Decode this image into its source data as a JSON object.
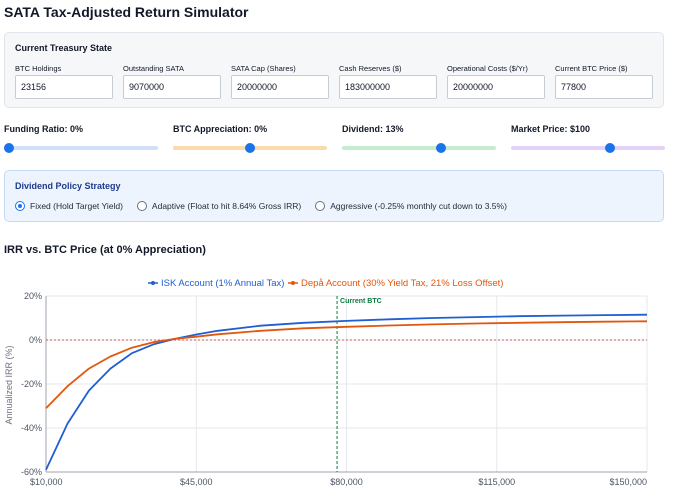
{
  "app": {
    "title": "SATA Tax-Adjusted Return Simulator"
  },
  "treasury": {
    "title": "Current Treasury State",
    "fields": [
      {
        "label": "BTC Holdings",
        "value": "23156"
      },
      {
        "label": "Outstanding SATA",
        "value": "9070000"
      },
      {
        "label": "SATA Cap (Shares)",
        "value": "20000000"
      },
      {
        "label": "Cash Reserves ($)",
        "value": "183000000"
      },
      {
        "label": "Operational Costs ($/Yr)",
        "value": "20000000"
      },
      {
        "label": "Current BTC Price ($)",
        "value": "77800"
      }
    ]
  },
  "sliders": [
    {
      "label": "Funding Ratio: 0%",
      "level": 0.0,
      "track_color": "#cfe0f7"
    },
    {
      "label": "BTC Appreciation: 0%",
      "level": 0.5,
      "track_color": "#fbdba9"
    },
    {
      "label": "Dividend: 13%",
      "level": 0.65,
      "track_color": "#c3edcc"
    },
    {
      "label": "Market Price: $100",
      "level": 0.65,
      "track_color": "#e5d2f7"
    }
  ],
  "policy": {
    "title": "Dividend Policy Strategy",
    "options": [
      {
        "label": "Fixed (Hold Target Yield)",
        "selected": true
      },
      {
        "label": "Adaptive (Float to hit 8.64% Gross IRR)",
        "selected": false
      },
      {
        "label": "Aggressive (-0.25% monthly cut down to 3.5%)",
        "selected": false
      }
    ]
  },
  "chart": {
    "title": "IRR vs. BTC Price (at 0% Appreciation)"
  },
  "chart_data": {
    "type": "line",
    "ylabel": "Annualized IRR (%)",
    "xlim": [
      10000,
      150000
    ],
    "ylim": [
      -60,
      20
    ],
    "x_ticks": [
      "$10,000",
      "$45,000",
      "$80,000",
      "$115,000",
      "$150,000"
    ],
    "y_ticks": [
      "20%",
      "0%",
      "-20%",
      "-40%",
      "-60%"
    ],
    "legend_position": "top-center",
    "zero_line": true,
    "current_marker": {
      "label": "Current BTC",
      "x": 77800
    },
    "series": [
      {
        "name": "ISK Account (1% Annual Tax)",
        "color": "#1f5fd1",
        "x": [
          10000,
          15000,
          20000,
          25000,
          30000,
          35000,
          40000,
          45000,
          50000,
          60000,
          70000,
          80000,
          90000,
          100000,
          110000,
          120000,
          130000,
          140000,
          150000
        ],
        "y": [
          -59,
          -38,
          -23,
          -13,
          -6,
          -2,
          0.5,
          2.5,
          4.2,
          6.5,
          7.8,
          8.7,
          9.4,
          10.0,
          10.4,
          10.8,
          11.1,
          11.3,
          11.5
        ]
      },
      {
        "name": "Depå Account (30% Yield Tax, 21% Loss Offset)",
        "color": "#e2570f",
        "x": [
          10000,
          15000,
          20000,
          25000,
          30000,
          35000,
          40000,
          45000,
          50000,
          60000,
          70000,
          80000,
          90000,
          100000,
          110000,
          120000,
          130000,
          140000,
          150000
        ],
        "y": [
          -31,
          -21,
          -13,
          -7.5,
          -3.5,
          -1,
          0.5,
          1.5,
          2.6,
          4.2,
          5.3,
          6.0,
          6.6,
          7.1,
          7.5,
          7.8,
          8.1,
          8.3,
          8.5
        ]
      }
    ]
  }
}
